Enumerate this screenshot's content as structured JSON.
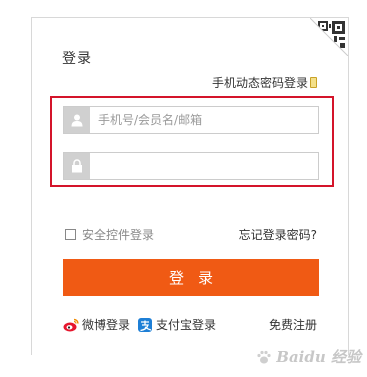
{
  "login": {
    "title": "登录",
    "phone_login_link": "手机动态密码登录",
    "username_placeholder": "手机号/会员名/邮箱",
    "password_placeholder": "",
    "secure_control_label": "安全控件登录",
    "forgot_password_link": "忘记登录密码?",
    "submit_label": "登录",
    "weibo_label": "微博登录",
    "alipay_label": "支付宝登录",
    "register_link": "免费注册"
  },
  "watermark": {
    "text": "Baidu 经验"
  },
  "colors": {
    "accent": "#f05a14",
    "highlight": "#d4142a",
    "icon_bg": "#d0d0d0"
  },
  "icons": {
    "qr": "qr-code-icon",
    "phone": "phone-icon",
    "user": "user-icon",
    "lock": "lock-icon",
    "weibo": "weibo-icon",
    "alipay": "alipay-icon"
  }
}
